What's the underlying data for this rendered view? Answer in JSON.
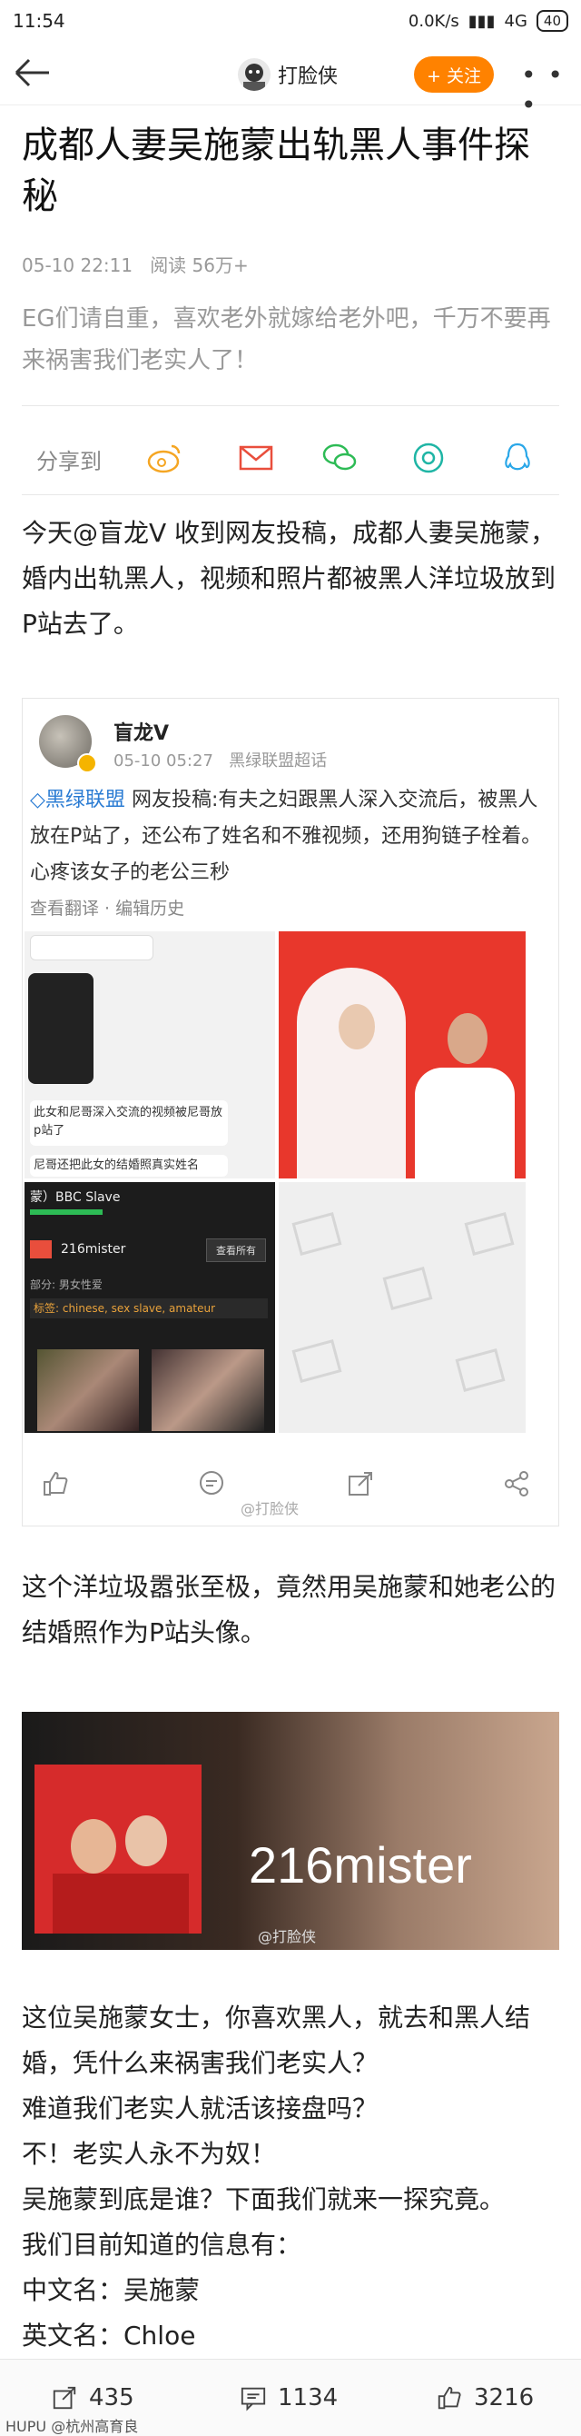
{
  "status_bar": {
    "time": "11:54",
    "network": "0.0K/s",
    "signal": "4G",
    "battery": "40"
  },
  "nav": {
    "author": "打脸侠",
    "follow_label": "+ 关注",
    "more_label": "• • •"
  },
  "article": {
    "title": "成都人妻吴施蒙出轨黑人事件探秘",
    "date": "05-10 22:11",
    "reads": "阅读 56万+",
    "summary": "EG们请自重，喜欢老外就嫁给老外吧，千万不要再来祸害我们老实人了！",
    "share_label": "分享到",
    "para1": "今天@盲龙V 收到网友投稿，成都人妻吴施蒙，婚内出轨黑人，视频和照片都被黑人洋垃圾放到P站去了。",
    "para2": "这个洋垃圾嚣张至极，竟然用吴施蒙和她老公的结婚照作为P站头像。",
    "para3_lines": [
      "这位吴施蒙女士，你喜欢黑人，就去和黑人结婚，凭什么来祸害我们老实人？",
      "难道我们老实人就活该接盘吗？",
      "不！老实人永不为奴！",
      "吴施蒙到底是谁？下面我们就来一探究竟。",
      "我们目前知道的信息有：",
      "中文名：吴施蒙",
      "英文名：Chloe"
    ]
  },
  "embedded_post": {
    "author": "盲龙V",
    "date": "05-10 05:27",
    "source": "黑绿联盟超话",
    "tag": "黑绿联盟",
    "text": "网友投稿:有夫之妇跟黑人深入交流后，被黑人放在P站了，还公布了姓名和不雅视频，还用狗链子栓着。心疼该女子的老公三秒",
    "links": "查看翻译 · 编辑历史",
    "chat_bubble1": "此女和尼哥深入交流的视频被尼哥放p站了",
    "chat_bubble2": "尼哥还把此女的结婚照真实姓名",
    "profile_title": "蒙）BBC Slave",
    "profile_name": "216mister",
    "profile_tags": "标签: chinese, sex slave, amateur",
    "profile_gender": "部分: 男女性爱",
    "profile_btn": "查看所有",
    "watermark": "@打脸侠"
  },
  "banner": {
    "text": "216mister",
    "watermark": "@打脸侠"
  },
  "bottom_bar": {
    "shares": "435",
    "comments": "1134",
    "likes": "3216",
    "watermark": "HUPU @杭州高育良"
  }
}
